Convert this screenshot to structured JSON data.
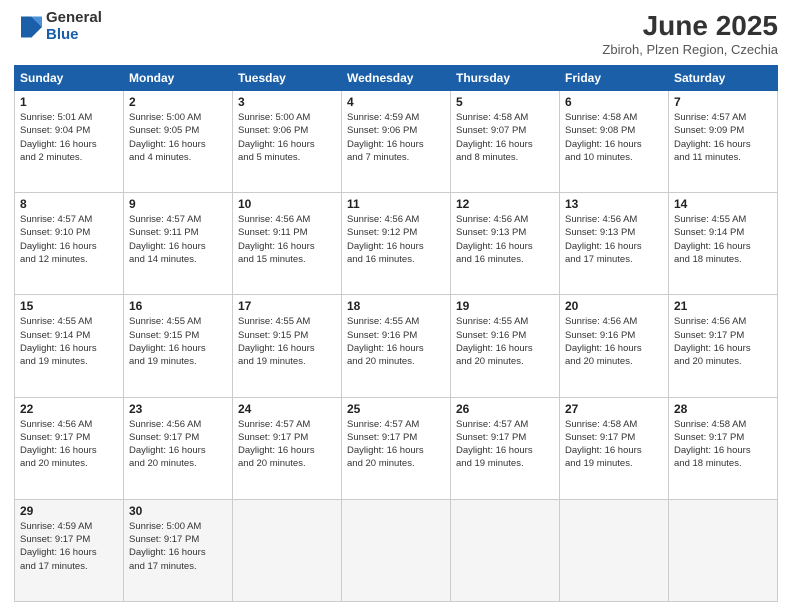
{
  "logo": {
    "general": "General",
    "blue": "Blue"
  },
  "header": {
    "title": "June 2025",
    "location": "Zbiroh, Plzen Region, Czechia"
  },
  "weekdays": [
    "Sunday",
    "Monday",
    "Tuesday",
    "Wednesday",
    "Thursday",
    "Friday",
    "Saturday"
  ],
  "weeks": [
    [
      {
        "day": "1",
        "info": "Sunrise: 5:01 AM\nSunset: 9:04 PM\nDaylight: 16 hours\nand 2 minutes."
      },
      {
        "day": "2",
        "info": "Sunrise: 5:00 AM\nSunset: 9:05 PM\nDaylight: 16 hours\nand 4 minutes."
      },
      {
        "day": "3",
        "info": "Sunrise: 5:00 AM\nSunset: 9:06 PM\nDaylight: 16 hours\nand 5 minutes."
      },
      {
        "day": "4",
        "info": "Sunrise: 4:59 AM\nSunset: 9:06 PM\nDaylight: 16 hours\nand 7 minutes."
      },
      {
        "day": "5",
        "info": "Sunrise: 4:58 AM\nSunset: 9:07 PM\nDaylight: 16 hours\nand 8 minutes."
      },
      {
        "day": "6",
        "info": "Sunrise: 4:58 AM\nSunset: 9:08 PM\nDaylight: 16 hours\nand 10 minutes."
      },
      {
        "day": "7",
        "info": "Sunrise: 4:57 AM\nSunset: 9:09 PM\nDaylight: 16 hours\nand 11 minutes."
      }
    ],
    [
      {
        "day": "8",
        "info": "Sunrise: 4:57 AM\nSunset: 9:10 PM\nDaylight: 16 hours\nand 12 minutes."
      },
      {
        "day": "9",
        "info": "Sunrise: 4:57 AM\nSunset: 9:11 PM\nDaylight: 16 hours\nand 14 minutes."
      },
      {
        "day": "10",
        "info": "Sunrise: 4:56 AM\nSunset: 9:11 PM\nDaylight: 16 hours\nand 15 minutes."
      },
      {
        "day": "11",
        "info": "Sunrise: 4:56 AM\nSunset: 9:12 PM\nDaylight: 16 hours\nand 16 minutes."
      },
      {
        "day": "12",
        "info": "Sunrise: 4:56 AM\nSunset: 9:13 PM\nDaylight: 16 hours\nand 16 minutes."
      },
      {
        "day": "13",
        "info": "Sunrise: 4:56 AM\nSunset: 9:13 PM\nDaylight: 16 hours\nand 17 minutes."
      },
      {
        "day": "14",
        "info": "Sunrise: 4:55 AM\nSunset: 9:14 PM\nDaylight: 16 hours\nand 18 minutes."
      }
    ],
    [
      {
        "day": "15",
        "info": "Sunrise: 4:55 AM\nSunset: 9:14 PM\nDaylight: 16 hours\nand 19 minutes."
      },
      {
        "day": "16",
        "info": "Sunrise: 4:55 AM\nSunset: 9:15 PM\nDaylight: 16 hours\nand 19 minutes."
      },
      {
        "day": "17",
        "info": "Sunrise: 4:55 AM\nSunset: 9:15 PM\nDaylight: 16 hours\nand 19 minutes."
      },
      {
        "day": "18",
        "info": "Sunrise: 4:55 AM\nSunset: 9:16 PM\nDaylight: 16 hours\nand 20 minutes."
      },
      {
        "day": "19",
        "info": "Sunrise: 4:55 AM\nSunset: 9:16 PM\nDaylight: 16 hours\nand 20 minutes."
      },
      {
        "day": "20",
        "info": "Sunrise: 4:56 AM\nSunset: 9:16 PM\nDaylight: 16 hours\nand 20 minutes."
      },
      {
        "day": "21",
        "info": "Sunrise: 4:56 AM\nSunset: 9:17 PM\nDaylight: 16 hours\nand 20 minutes."
      }
    ],
    [
      {
        "day": "22",
        "info": "Sunrise: 4:56 AM\nSunset: 9:17 PM\nDaylight: 16 hours\nand 20 minutes."
      },
      {
        "day": "23",
        "info": "Sunrise: 4:56 AM\nSunset: 9:17 PM\nDaylight: 16 hours\nand 20 minutes."
      },
      {
        "day": "24",
        "info": "Sunrise: 4:57 AM\nSunset: 9:17 PM\nDaylight: 16 hours\nand 20 minutes."
      },
      {
        "day": "25",
        "info": "Sunrise: 4:57 AM\nSunset: 9:17 PM\nDaylight: 16 hours\nand 20 minutes."
      },
      {
        "day": "26",
        "info": "Sunrise: 4:57 AM\nSunset: 9:17 PM\nDaylight: 16 hours\nand 19 minutes."
      },
      {
        "day": "27",
        "info": "Sunrise: 4:58 AM\nSunset: 9:17 PM\nDaylight: 16 hours\nand 19 minutes."
      },
      {
        "day": "28",
        "info": "Sunrise: 4:58 AM\nSunset: 9:17 PM\nDaylight: 16 hours\nand 18 minutes."
      }
    ],
    [
      {
        "day": "29",
        "info": "Sunrise: 4:59 AM\nSunset: 9:17 PM\nDaylight: 16 hours\nand 17 minutes."
      },
      {
        "day": "30",
        "info": "Sunrise: 5:00 AM\nSunset: 9:17 PM\nDaylight: 16 hours\nand 17 minutes."
      },
      {
        "day": "",
        "info": ""
      },
      {
        "day": "",
        "info": ""
      },
      {
        "day": "",
        "info": ""
      },
      {
        "day": "",
        "info": ""
      },
      {
        "day": "",
        "info": ""
      }
    ]
  ]
}
